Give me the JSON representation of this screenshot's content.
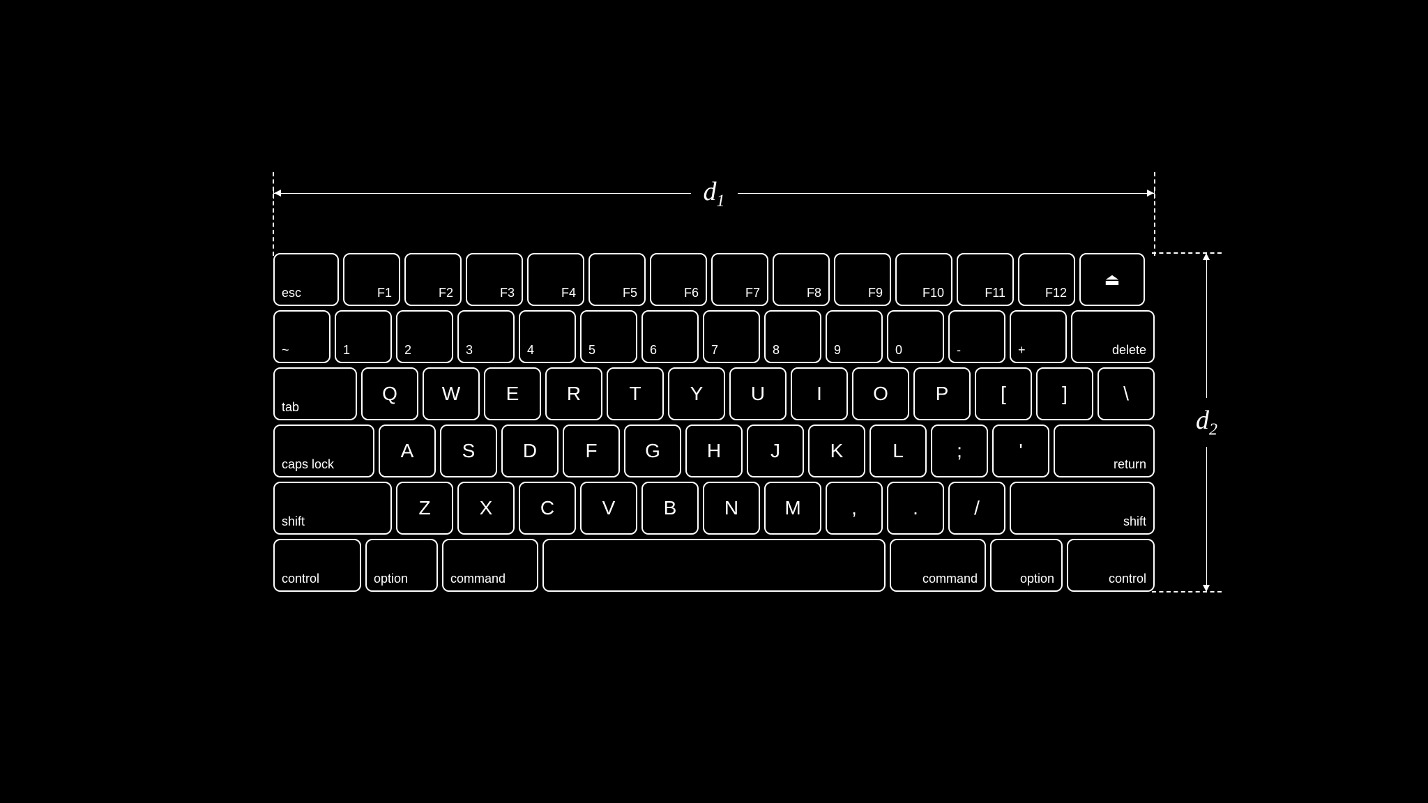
{
  "diagram": {
    "d1_label": "d",
    "d1_sub": "1",
    "d2_label": "d",
    "d2_sub": "2"
  },
  "keyboard": {
    "rows": [
      {
        "id": "row-fn",
        "keys": [
          {
            "id": "esc",
            "label": "esc",
            "type": "esc"
          },
          {
            "id": "f1",
            "label": "F1",
            "type": "f-key"
          },
          {
            "id": "f2",
            "label": "F2",
            "type": "f-key"
          },
          {
            "id": "f3",
            "label": "F3",
            "type": "f-key"
          },
          {
            "id": "f4",
            "label": "F4",
            "type": "f-key"
          },
          {
            "id": "f5",
            "label": "F5",
            "type": "f-key"
          },
          {
            "id": "f6",
            "label": "F6",
            "type": "f-key"
          },
          {
            "id": "f7",
            "label": "F7",
            "type": "f-key"
          },
          {
            "id": "f8",
            "label": "F8",
            "type": "f-key"
          },
          {
            "id": "f9",
            "label": "F9",
            "type": "f-key"
          },
          {
            "id": "f10",
            "label": "F10",
            "type": "f-key"
          },
          {
            "id": "f11",
            "label": "F11",
            "type": "f-key"
          },
          {
            "id": "f12",
            "label": "F12",
            "type": "f-key"
          },
          {
            "id": "eject",
            "label": "⏏",
            "type": "eject"
          }
        ]
      },
      {
        "id": "row-num",
        "keys": [
          {
            "id": "tilde",
            "label": "~",
            "type": "num"
          },
          {
            "id": "1",
            "label": "1",
            "type": "num"
          },
          {
            "id": "2",
            "label": "2",
            "type": "num"
          },
          {
            "id": "3",
            "label": "3",
            "type": "num"
          },
          {
            "id": "4",
            "label": "4",
            "type": "num"
          },
          {
            "id": "5",
            "label": "5",
            "type": "num"
          },
          {
            "id": "6",
            "label": "6",
            "type": "num"
          },
          {
            "id": "7",
            "label": "7",
            "type": "num"
          },
          {
            "id": "8",
            "label": "8",
            "type": "num"
          },
          {
            "id": "9",
            "label": "9",
            "type": "num"
          },
          {
            "id": "0",
            "label": "0",
            "type": "num"
          },
          {
            "id": "minus",
            "label": "-",
            "type": "num"
          },
          {
            "id": "plus",
            "label": "+",
            "type": "num"
          },
          {
            "id": "delete",
            "label": "delete",
            "type": "delete"
          }
        ]
      },
      {
        "id": "row-qwerty",
        "keys": [
          {
            "id": "tab",
            "label": "tab",
            "type": "tab"
          },
          {
            "id": "q",
            "label": "Q",
            "type": "letter"
          },
          {
            "id": "w",
            "label": "W",
            "type": "letter"
          },
          {
            "id": "e",
            "label": "E",
            "type": "letter"
          },
          {
            "id": "r",
            "label": "R",
            "type": "letter"
          },
          {
            "id": "t",
            "label": "T",
            "type": "letter"
          },
          {
            "id": "y",
            "label": "Y",
            "type": "letter"
          },
          {
            "id": "u",
            "label": "U",
            "type": "letter"
          },
          {
            "id": "i",
            "label": "I",
            "type": "letter"
          },
          {
            "id": "o",
            "label": "O",
            "type": "letter"
          },
          {
            "id": "p",
            "label": "P",
            "type": "letter"
          },
          {
            "id": "lbracket",
            "label": "[",
            "type": "letter"
          },
          {
            "id": "rbracket",
            "label": "]",
            "type": "letter"
          },
          {
            "id": "backslash",
            "label": "\\",
            "type": "letter"
          }
        ]
      },
      {
        "id": "row-home",
        "keys": [
          {
            "id": "caps",
            "label": "caps lock",
            "type": "caps"
          },
          {
            "id": "a",
            "label": "A",
            "type": "letter"
          },
          {
            "id": "s",
            "label": "S",
            "type": "letter"
          },
          {
            "id": "d",
            "label": "D",
            "type": "letter"
          },
          {
            "id": "f",
            "label": "F",
            "type": "letter"
          },
          {
            "id": "g",
            "label": "G",
            "type": "letter"
          },
          {
            "id": "h",
            "label": "H",
            "type": "letter"
          },
          {
            "id": "j",
            "label": "J",
            "type": "letter"
          },
          {
            "id": "k",
            "label": "K",
            "type": "letter"
          },
          {
            "id": "l",
            "label": "L",
            "type": "letter"
          },
          {
            "id": "semicolon",
            "label": ";",
            "type": "letter"
          },
          {
            "id": "quote",
            "label": "'",
            "type": "letter"
          },
          {
            "id": "return",
            "label": "return",
            "type": "return"
          }
        ]
      },
      {
        "id": "row-shift",
        "keys": [
          {
            "id": "shift-l",
            "label": "shift",
            "type": "shift-l"
          },
          {
            "id": "z",
            "label": "Z",
            "type": "letter"
          },
          {
            "id": "x",
            "label": "X",
            "type": "letter"
          },
          {
            "id": "c",
            "label": "C",
            "type": "letter"
          },
          {
            "id": "v",
            "label": "V",
            "type": "letter"
          },
          {
            "id": "b",
            "label": "B",
            "type": "letter"
          },
          {
            "id": "n",
            "label": "N",
            "type": "letter"
          },
          {
            "id": "m",
            "label": "M",
            "type": "letter"
          },
          {
            "id": "comma",
            "label": ",",
            "type": "letter"
          },
          {
            "id": "period",
            "label": ".",
            "type": "letter"
          },
          {
            "id": "slash",
            "label": "/",
            "type": "letter"
          },
          {
            "id": "shift-r",
            "label": "shift",
            "type": "shift-r"
          }
        ]
      },
      {
        "id": "row-bottom",
        "keys": [
          {
            "id": "control-l",
            "label": "control",
            "type": "control"
          },
          {
            "id": "option-l",
            "label": "option",
            "type": "option"
          },
          {
            "id": "command-l",
            "label": "command",
            "type": "command-l"
          },
          {
            "id": "space",
            "label": "",
            "type": "spacebar"
          },
          {
            "id": "command-r",
            "label": "command",
            "type": "command-r"
          },
          {
            "id": "option-r",
            "label": "option",
            "type": "option-r"
          },
          {
            "id": "control-r",
            "label": "control",
            "type": "control-r"
          }
        ]
      }
    ]
  }
}
